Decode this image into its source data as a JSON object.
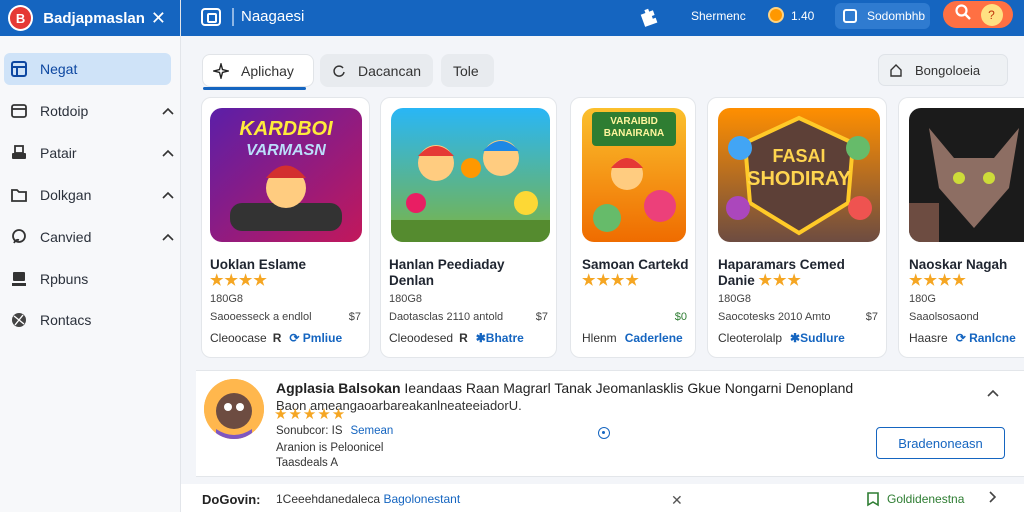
{
  "sidebar": {
    "title": "Badjapmaslan",
    "logo_text": "B",
    "items": [
      {
        "label": "Negat",
        "icon": "layout-icon",
        "active": true
      },
      {
        "label": "Rotdoip",
        "icon": "window-icon"
      },
      {
        "label": "Patair",
        "icon": "printer-icon"
      },
      {
        "label": "Dolkgan",
        "icon": "folder-icon"
      },
      {
        "label": "Canvied",
        "icon": "link-icon"
      },
      {
        "label": "Rpbuns",
        "icon": "monitor-icon"
      },
      {
        "label": "Rontacs",
        "icon": "globe-icon"
      }
    ]
  },
  "topbar": {
    "title": "Naagaesi",
    "user": "Shermenc",
    "coins": "1.40",
    "button": "Sodombhb",
    "avatar": "?"
  },
  "tabs": [
    {
      "label": "Aplichay",
      "icon": "sparkle-icon",
      "active": true
    },
    {
      "label": "Dacancan",
      "icon": "refresh-icon"
    },
    {
      "label": "Tole"
    }
  ],
  "filter_label": "Bongoloeia",
  "cards": [
    {
      "title1": "Uoklan Eslame",
      "title2": "",
      "stars": "★★★★",
      "sub": "180G8",
      "meta_left": "Saooesseck a endlol",
      "meta_right": "$7",
      "foot_left": "Cleoocase",
      "foot_icon": "R",
      "foot_action": "Pmliue",
      "image_text1": "KARDBOI",
      "image_text2": "VARMASN"
    },
    {
      "title1": "Hanlan Peediaday",
      "title2": "Denlan",
      "stars": "",
      "sub": "180G8",
      "meta_left": "Daotasclas 2110 antold",
      "meta_right": "$7",
      "foot_left": "Cleoodesed",
      "foot_icon": "R",
      "foot_action": "Bhatre"
    },
    {
      "title1": "Samoan Cartekd",
      "title2": "",
      "stars": "★★★★",
      "sub": "",
      "meta_left": "",
      "meta_right": "$0",
      "foot_left": "Hlenm",
      "foot_icon": "",
      "foot_action": "Caderlene",
      "image_text1": "VARAIBID",
      "image_text2": "BANAIRANA"
    },
    {
      "title1": "Haparamars Cemed",
      "title2": "Danie",
      "stars": "★★★",
      "sub": "180G8",
      "meta_left": "Saocotesks 2010 Amto",
      "meta_right": "$7",
      "foot_left": "Cleoterolalp",
      "foot_icon": "",
      "foot_action": "Sudlure",
      "image_text1": "FASAI",
      "image_text2": "SHODIRAY"
    },
    {
      "title1": "Naoskar Nagah",
      "title2": "",
      "stars": "★★★★",
      "sub": "180G",
      "meta_left": "Saaolsosaond",
      "meta_right": "",
      "foot_left": "Haasre",
      "foot_icon": "",
      "foot_action": "Ranlcne"
    }
  ],
  "detail": {
    "title_bold": "Agplasia Balsokan",
    "title_rest": " Ieandaas Raan Magrarl Tanak Jeomanlasklis Gkue Nongarni Denopland",
    "description": "Baon ameangaoarbareakanlneateeiadorU.",
    "stars": "★★★★★",
    "line1": "Sonubcor: IS",
    "line1_link": "Semean",
    "line2": "Aranion is Peloonicel",
    "line3": "Taasdeals A",
    "button": "Bradenoneasn"
  },
  "footer": {
    "label": "DoGovin:",
    "text": "1Ceeehdanedaleca",
    "link": "Bagolonestant",
    "badge": "Goldidenestna"
  }
}
